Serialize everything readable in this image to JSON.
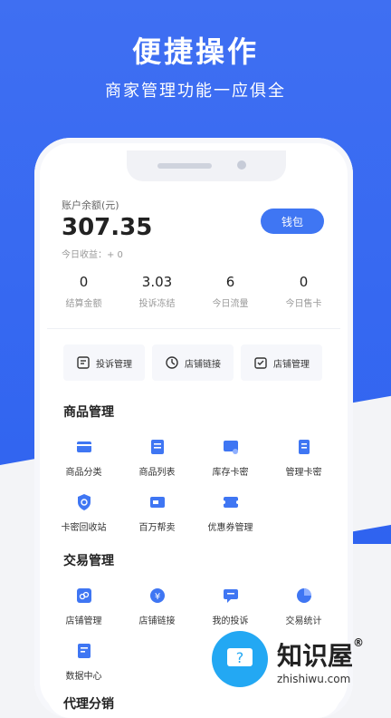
{
  "promo": {
    "headline": "便捷操作",
    "subline": "商家管理功能一应俱全"
  },
  "account": {
    "balance_label": "账户余额(元)",
    "balance_value": "307.35",
    "today_income": "今日收益：+ 0",
    "wallet_label": "钱包"
  },
  "stats": [
    {
      "value": "0",
      "label": "结算金额"
    },
    {
      "value": "3.03",
      "label": "投诉冻结"
    },
    {
      "value": "6",
      "label": "今日流量"
    },
    {
      "value": "0",
      "label": "今日售卡"
    }
  ],
  "quick_actions": [
    {
      "label": "投诉管理",
      "icon": "complaint-icon"
    },
    {
      "label": "店铺链接",
      "icon": "clock-link-icon"
    },
    {
      "label": "店铺管理",
      "icon": "shop-manage-icon"
    }
  ],
  "sections": {
    "goods_title": "商品管理",
    "goods_items": [
      {
        "label": "商品分类",
        "icon": "card-category-icon"
      },
      {
        "label": "商品列表",
        "icon": "list-icon"
      },
      {
        "label": "库存卡密",
        "icon": "inventory-card-icon"
      },
      {
        "label": "管理卡密",
        "icon": "manage-card-icon"
      },
      {
        "label": "卡密回收站",
        "icon": "recycle-shield-icon"
      },
      {
        "label": "百万帮卖",
        "icon": "sell-help-icon"
      },
      {
        "label": "优惠券管理",
        "icon": "coupon-icon"
      }
    ],
    "trade_title": "交易管理",
    "trade_items": [
      {
        "label": "店铺管理",
        "icon": "shop-link-icon"
      },
      {
        "label": "店铺链接",
        "icon": "yen-icon"
      },
      {
        "label": "我的投诉",
        "icon": "chat-icon"
      },
      {
        "label": "交易统计",
        "icon": "pie-icon"
      },
      {
        "label": "数据中心",
        "icon": "data-center-icon"
      }
    ],
    "agent_title": "代理分销"
  },
  "watermark": {
    "brand": "知识屋",
    "reg": "®",
    "domain": "zhishiwu.com"
  },
  "colors": {
    "primary": "#3f76f3",
    "background_blue": "#2f63f0"
  }
}
